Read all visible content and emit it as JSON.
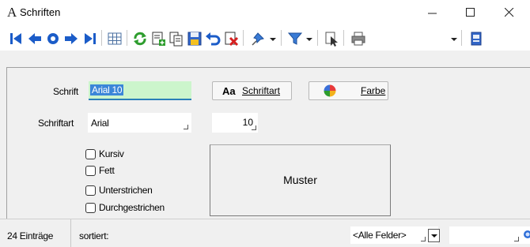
{
  "window": {
    "app_icon": "A",
    "title": "Schriften"
  },
  "toolbar": {
    "icons": [
      "first-record-icon",
      "prev-record-icon",
      "search-record-icon",
      "next-record-icon",
      "last-record-icon",
      "table-icon",
      "refresh-icon",
      "new-record-icon",
      "copy-record-icon",
      "save-icon",
      "undo-icon",
      "delete-icon",
      "pin-icon",
      "filter-icon",
      "select-icon",
      "print-icon",
      "app-icon"
    ]
  },
  "form": {
    "schrift_label": "Schrift",
    "schrift_value": "Arial 10",
    "schriftart_label": "Schriftart",
    "schriftart_value": "Arial",
    "size_value": "10",
    "btn_schriftart_prefix": "Aa",
    "btn_schriftart_label": "Schriftart",
    "btn_farbe_label": "Farbe",
    "checkboxes": [
      {
        "label": "Kursiv",
        "checked": false
      },
      {
        "label": "Fett",
        "checked": false
      },
      {
        "label": "Unterstrichen",
        "checked": false
      },
      {
        "label": "Durchgestrichen",
        "checked": false
      }
    ],
    "muster_label": "Muster"
  },
  "status": {
    "entries": "24 Einträge",
    "sorted_label": "sortiert:",
    "fields_selected": "<Alle Felder>"
  },
  "colors": {
    "accent": "#3b86d8",
    "input_bg": "#ccf5cc",
    "nav_blue": "#1b5cc8"
  }
}
